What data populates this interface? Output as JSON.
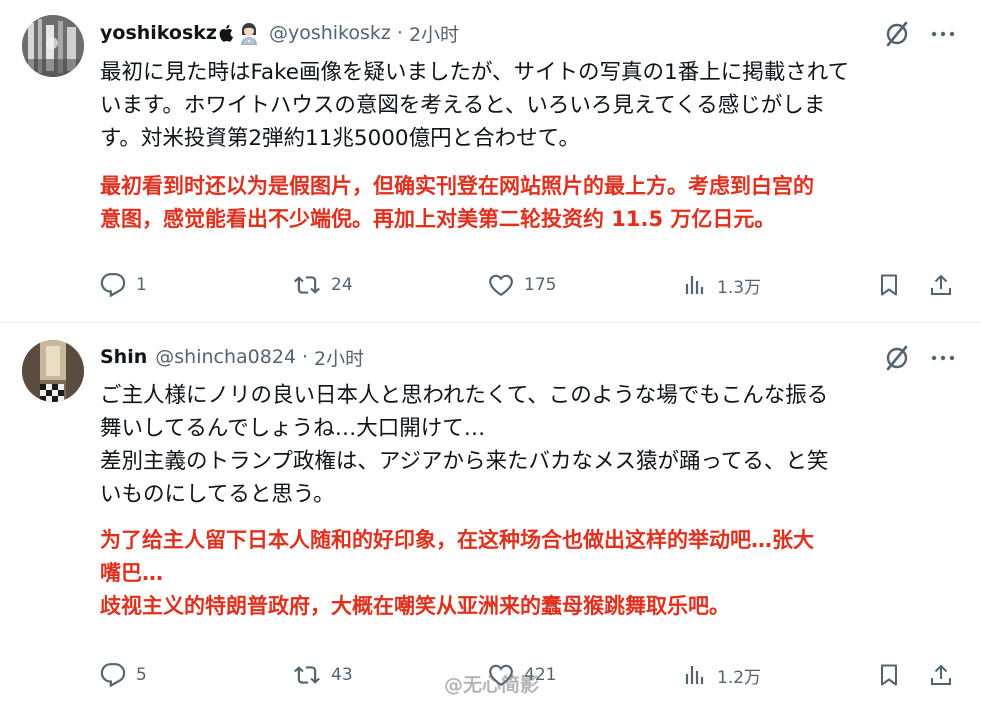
{
  "posts": [
    {
      "name": "yoshikoskz",
      "badges": [
        "apple-icon",
        "woman-technologist-emoji"
      ],
      "handle": "@yoshikoskz",
      "separator": "·",
      "time": "2小时",
      "text_ja": [
        "最初に見た時はFake画像を疑いましたが、サイトの写真の1番上に掲載されて",
        "います。ホワイトハウスの意図を考えると、いろいろ見えてくる感じがしま",
        "す。対米投資第2弾約11兆5000億円と合わせて。"
      ],
      "text_zh": [
        "最初看到时还以为是假图片，但确实刊登在网站照片的最上方。考虑到白宫的",
        "意图，感觉能看出不少端倪。再加上对美第二轮投资约 11.5 万亿日元。"
      ],
      "replies": "1",
      "reposts": "24",
      "likes": "175",
      "views": "1.3万"
    },
    {
      "name": "Shin",
      "handle": "@shincha0824",
      "separator": "·",
      "time": "2小时",
      "text_ja": [
        "ご主人様にノリの良い日本人と思われたくて、このような場でもこんな振る",
        "舞いしてるんでしょうね…大口開けて…",
        "差別主義のトランプ政権は、アジアから来たバカなメス猿が踊ってる、と笑",
        "いものにしてると思う。"
      ],
      "text_zh": [
        "为了给主人留下日本人随和的好印象，在这种场合也做出这样的举动吧…张大",
        "嘴巴…",
        "歧视主义的特朗普政府，大概在嘲笑从亚洲来的蠢母猴跳舞取乐吧。"
      ],
      "replies": "5",
      "reposts": "43",
      "likes": "421",
      "views": "1.2万"
    }
  ],
  "watermark": "@无心简影",
  "colors": {
    "text": "#0f1419",
    "secondary": "#536471",
    "translation": "#e0301e",
    "divider": "#eff3f4"
  }
}
